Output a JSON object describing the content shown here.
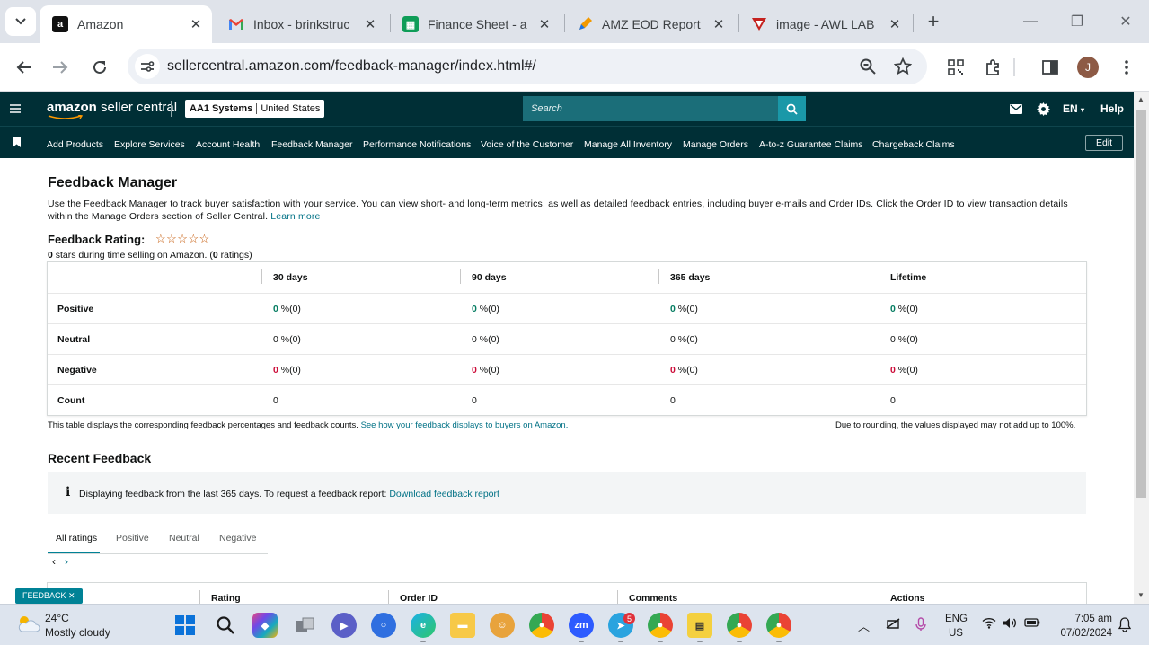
{
  "browser": {
    "tabs": [
      {
        "title": "Amazon",
        "icon": "amazon-icon",
        "active": true
      },
      {
        "title": "Inbox - brinkstruc",
        "icon": "gmail-icon",
        "active": false
      },
      {
        "title": "Finance Sheet - a",
        "icon": "sheets-icon",
        "active": false
      },
      {
        "title": "AMZ EOD Report",
        "icon": "pencil-app-icon",
        "active": false
      },
      {
        "title": "image - AWL LAB",
        "icon": "awl-icon",
        "active": false
      }
    ],
    "url": "sellercentral.amazon.com/feedback-manager/index.html#/",
    "profile_initial": "J"
  },
  "seller_central": {
    "logo_brand": "amazon",
    "logo_product": " seller central",
    "account_name": "AA1 Systems",
    "account_region": "United States",
    "search_placeholder": "Search",
    "language": "EN",
    "help": "Help",
    "nav_items": [
      "Add Products",
      "Explore Services",
      "Account Health",
      "Feedback Manager",
      "Performance Notifications",
      "Voice of the Customer",
      "Manage All Inventory",
      "Manage Orders",
      "A-to-z Guarantee Claims",
      "Chargeback Claims"
    ],
    "edit_label": "Edit"
  },
  "feedback_manager": {
    "title": "Feedback Manager",
    "intro": "Use the Feedback Manager to track buyer satisfaction with your service. You can view short- and long-term metrics, as well as detailed feedback entries, including buyer e-mails and Order IDs. Click the Order ID to view transaction details within the Manage Orders section of Seller Central.",
    "learn_more": "Learn more",
    "rating_title": "Feedback Rating:",
    "stars": "☆☆☆☆☆",
    "rating_stars_value": "0",
    "rating_mid": " stars during time selling on Amazon. (",
    "rating_count": "0",
    "rating_end": " ratings)",
    "table": {
      "headers": [
        "30 days",
        "90 days",
        "365 days",
        "Lifetime"
      ],
      "rows": [
        {
          "label": "Positive",
          "values": [
            "0",
            "0",
            "0",
            "0"
          ],
          "suffix": " %(0)"
        },
        {
          "label": "Neutral",
          "values": [
            "0",
            "0",
            "0",
            "0"
          ],
          "suffix": " %(0)"
        },
        {
          "label": "Negative",
          "values": [
            "0",
            "0",
            "0",
            "0"
          ],
          "suffix": " %(0)"
        },
        {
          "label": "Count",
          "values": [
            "0",
            "0",
            "0",
            "0"
          ],
          "suffix": ""
        }
      ]
    },
    "note_left": "This table displays the corresponding feedback percentages and feedback counts.",
    "note_left_link": "See how your feedback displays to buyers on Amazon.",
    "note_right": "Due to rounding, the values displayed may not add up to 100%.",
    "recent_title": "Recent Feedback",
    "info_text": "Displaying feedback from the last 365 days. To request a feedback report:",
    "info_link": "Download feedback report",
    "filter_tabs": [
      "All ratings",
      "Positive",
      "Neutral",
      "Negative"
    ],
    "pager_prev": "‹",
    "pager_next": "›",
    "recent_columns": [
      "Rating",
      "Order ID",
      "Comments",
      "Actions"
    ],
    "feedback_pill": "FEEDBACK ✕"
  },
  "taskbar": {
    "temperature": "24°C",
    "weather": "Mostly cloudy",
    "lang_top": "ENG",
    "lang_bottom": "US",
    "time": "7:05 am",
    "date": "07/02/2024",
    "telegram_badge": "5"
  }
}
